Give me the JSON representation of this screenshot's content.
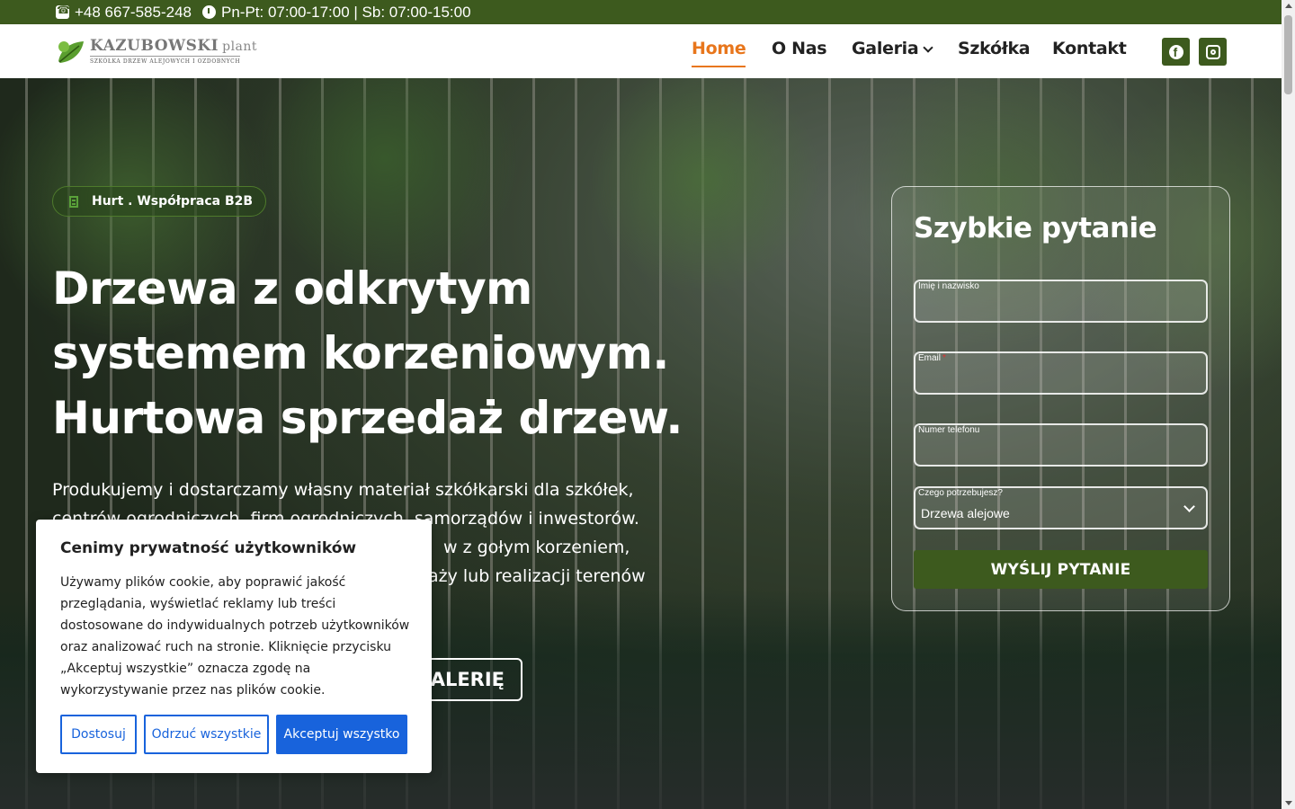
{
  "topbar": {
    "phone": "+48 667-585-248",
    "hours": "Pn-Pt: 07:00-17:00 | Sb: 07:00-15:00"
  },
  "logo": {
    "name": "KAZUBOWSKI",
    "suffix": "plant",
    "tagline": "SZKÓŁKA DRZEW ALEJOWYCH I OZDOBNYCH"
  },
  "nav": {
    "items": [
      {
        "label": "Home",
        "active": true
      },
      {
        "label": "O Nas"
      },
      {
        "label": "Galeria"
      },
      {
        "label": "Szkółka"
      },
      {
        "label": "Kontakt"
      }
    ],
    "social": [
      "facebook-icon",
      "instagram-icon"
    ]
  },
  "hero": {
    "badge": "Hurt . Współpraca B2B",
    "title": "Drzewa z odkrytym systemem korzeniowym. Hurtowa sprzedaż drzew.",
    "lead": "Produkujemy i dostarczamy własny materiał szkółkarski dla szkółek, centrów ogrodniczych, firm ogrodniczych, samorządów i inwestorów. ...w z gołym korzeniem, ...aży lub realizacji terenów",
    "lead_lines": [
      "Produkujemy i dostarczamy własny materiał szkółkarski dla szkółek,",
      "centrów ogrodniczych, firm ogrodniczych, samorządów i inwestorów.",
      "w z gołym korzeniem,",
      "aży lub realizacji terenów"
    ],
    "gallery_button": "GALERIĘ"
  },
  "form": {
    "title": "Szybkie pytanie",
    "name_label": "Imię i nazwisko",
    "email_label": "Email",
    "required_mark": "*",
    "phone_label": "Numer telefonu",
    "need_label": "Czego potrzebujesz?",
    "need_value": "Drzewa alejowe",
    "submit": "WYŚLIJ PYTANIE"
  },
  "cookie": {
    "title": "Cenimy prywatność użytkowników",
    "text": "Używamy plików cookie, aby poprawić jakość przeglądania, wyświetlać reklamy lub treści dostosowane do indywidualnych potrzeb użytkowników oraz analizować ruch na stronie. Kliknięcie przycisku „Akceptuj wszystkie” oznacza zgodę na wykorzystywanie przez nas plików cookie.",
    "customize": "Dostosuj",
    "reject": "Odrzuć wszystkie",
    "accept": "Akceptuj wszystko"
  },
  "colors": {
    "brand_green": "#3d5a1e",
    "accent_orange": "#e8761c",
    "cookie_blue": "#1863dc"
  }
}
